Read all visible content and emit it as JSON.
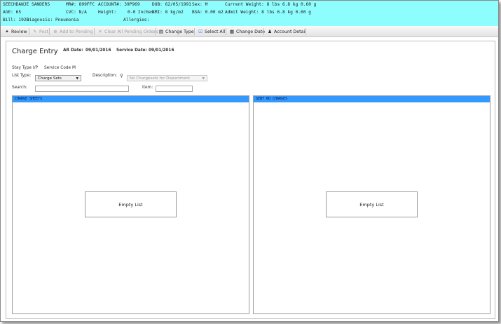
{
  "patient_banner": {
    "row1": [
      "SEECHDANJE SANDERS",
      "MR#: 899FFC",
      "ACCOUNT#: 39Р969",
      "DOB: 62/05/1991",
      "Sex: M",
      "Current Weight: 8 lbs 6.8 kg 0.60 g"
    ],
    "row2": [
      "AGE: 65",
      "CVC: N/A",
      "Height:",
      "0-0 Inches",
      "BMI: 8 kg/m2",
      "BSA: 0.00 m2",
      "Admit Weight: 8 lbs 6.8 kg 0.60 g"
    ],
    "row3": [
      "Bill: 1925",
      "Diagnosis: Pneumonia",
      "Allergies:"
    ]
  },
  "toolbar": {
    "review": "Review",
    "post": "Post",
    "add_to_pending": "Add to Pending",
    "clear_all_pending": "Clear All Pending Orders",
    "change_type": "Change Type",
    "select_all": "Select All",
    "change_date": "Change Date",
    "account_detail": "Account Detail"
  },
  "charge_entry": {
    "title": "Charge Entry",
    "ar_date_label": "AR Date:",
    "ar_date": "09/01/2016",
    "service_date_label": "Service Date:",
    "service_date": "09/01/2016",
    "stay_type": "Stay Type I/P",
    "service_code": "Service Code M",
    "list_type_label": "List Type:",
    "list_type_value": "Charge Sets",
    "description_label": "Description:",
    "description_value": "No Chargesets for Department",
    "search_label": "Search:",
    "search_value": "",
    "item_label": "Item:",
    "item_value": ""
  },
  "lists": {
    "left_header": "CHARGE SHEETS",
    "right_header": "SENT NO CHARGES",
    "left_empty": "Empty List",
    "right_empty": "Empty List"
  },
  "icons": {
    "review": "review-icon",
    "post": "post-icon",
    "add_to_pending": "add-pending-icon",
    "clear_all_pending": "clear-pending-icon",
    "change_type": "change-type-icon",
    "select_all": "select-all-icon",
    "change_date": "calendar-icon",
    "account_detail": "account-icon",
    "description_search": "search-icon"
  },
  "colors": {
    "banner_bg": "#8efdfd",
    "list_header_bg": "#3399ff"
  }
}
